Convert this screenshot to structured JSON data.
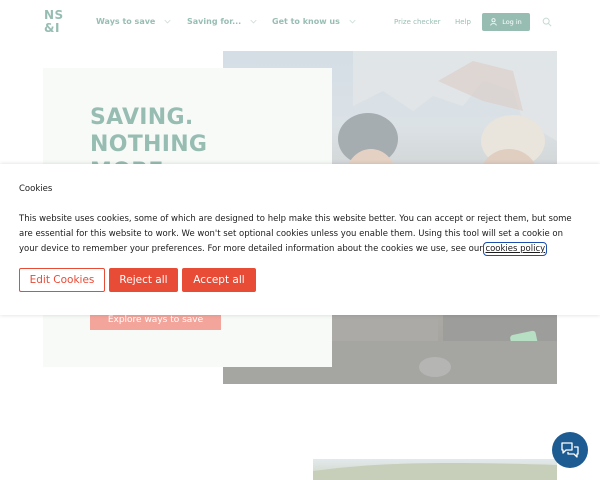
{
  "header": {
    "logo": "NS\n&I",
    "nav": [
      {
        "label": "Ways to save"
      },
      {
        "label": "Saving for..."
      },
      {
        "label": "Get to know us"
      }
    ],
    "links": {
      "prize_checker": "Prize checker",
      "help": "Help"
    },
    "login_label": "Log in"
  },
  "hero": {
    "heading": "SAVING.\nNOTHING\nMORE",
    "cta": "Explore ways to save"
  },
  "cookie_banner": {
    "title": "Cookies",
    "body_text": "This website uses cookies, some of which are designed to help make this website better. You can accept or reject them, but some are essential for this website to work. We won't set optional cookies unless you enable them. Using this tool will set a cookie on your device to remember your preferences. For more detailed information about the cookies we use, see our ",
    "link_text": "cookies policy",
    "buttons": {
      "edit": "Edit Cookies",
      "reject": "Reject all",
      "accept": "Accept all"
    }
  },
  "colors": {
    "brand_green": "#2f7a66",
    "accent_red": "#e84b36",
    "hero_card_bg": "#eef5ee",
    "chat_blue": "#1d5c93"
  },
  "icons": {
    "nav_chevron": "chevron-down-icon",
    "login": "user-icon",
    "search": "search-icon",
    "chat": "chat-icon"
  }
}
